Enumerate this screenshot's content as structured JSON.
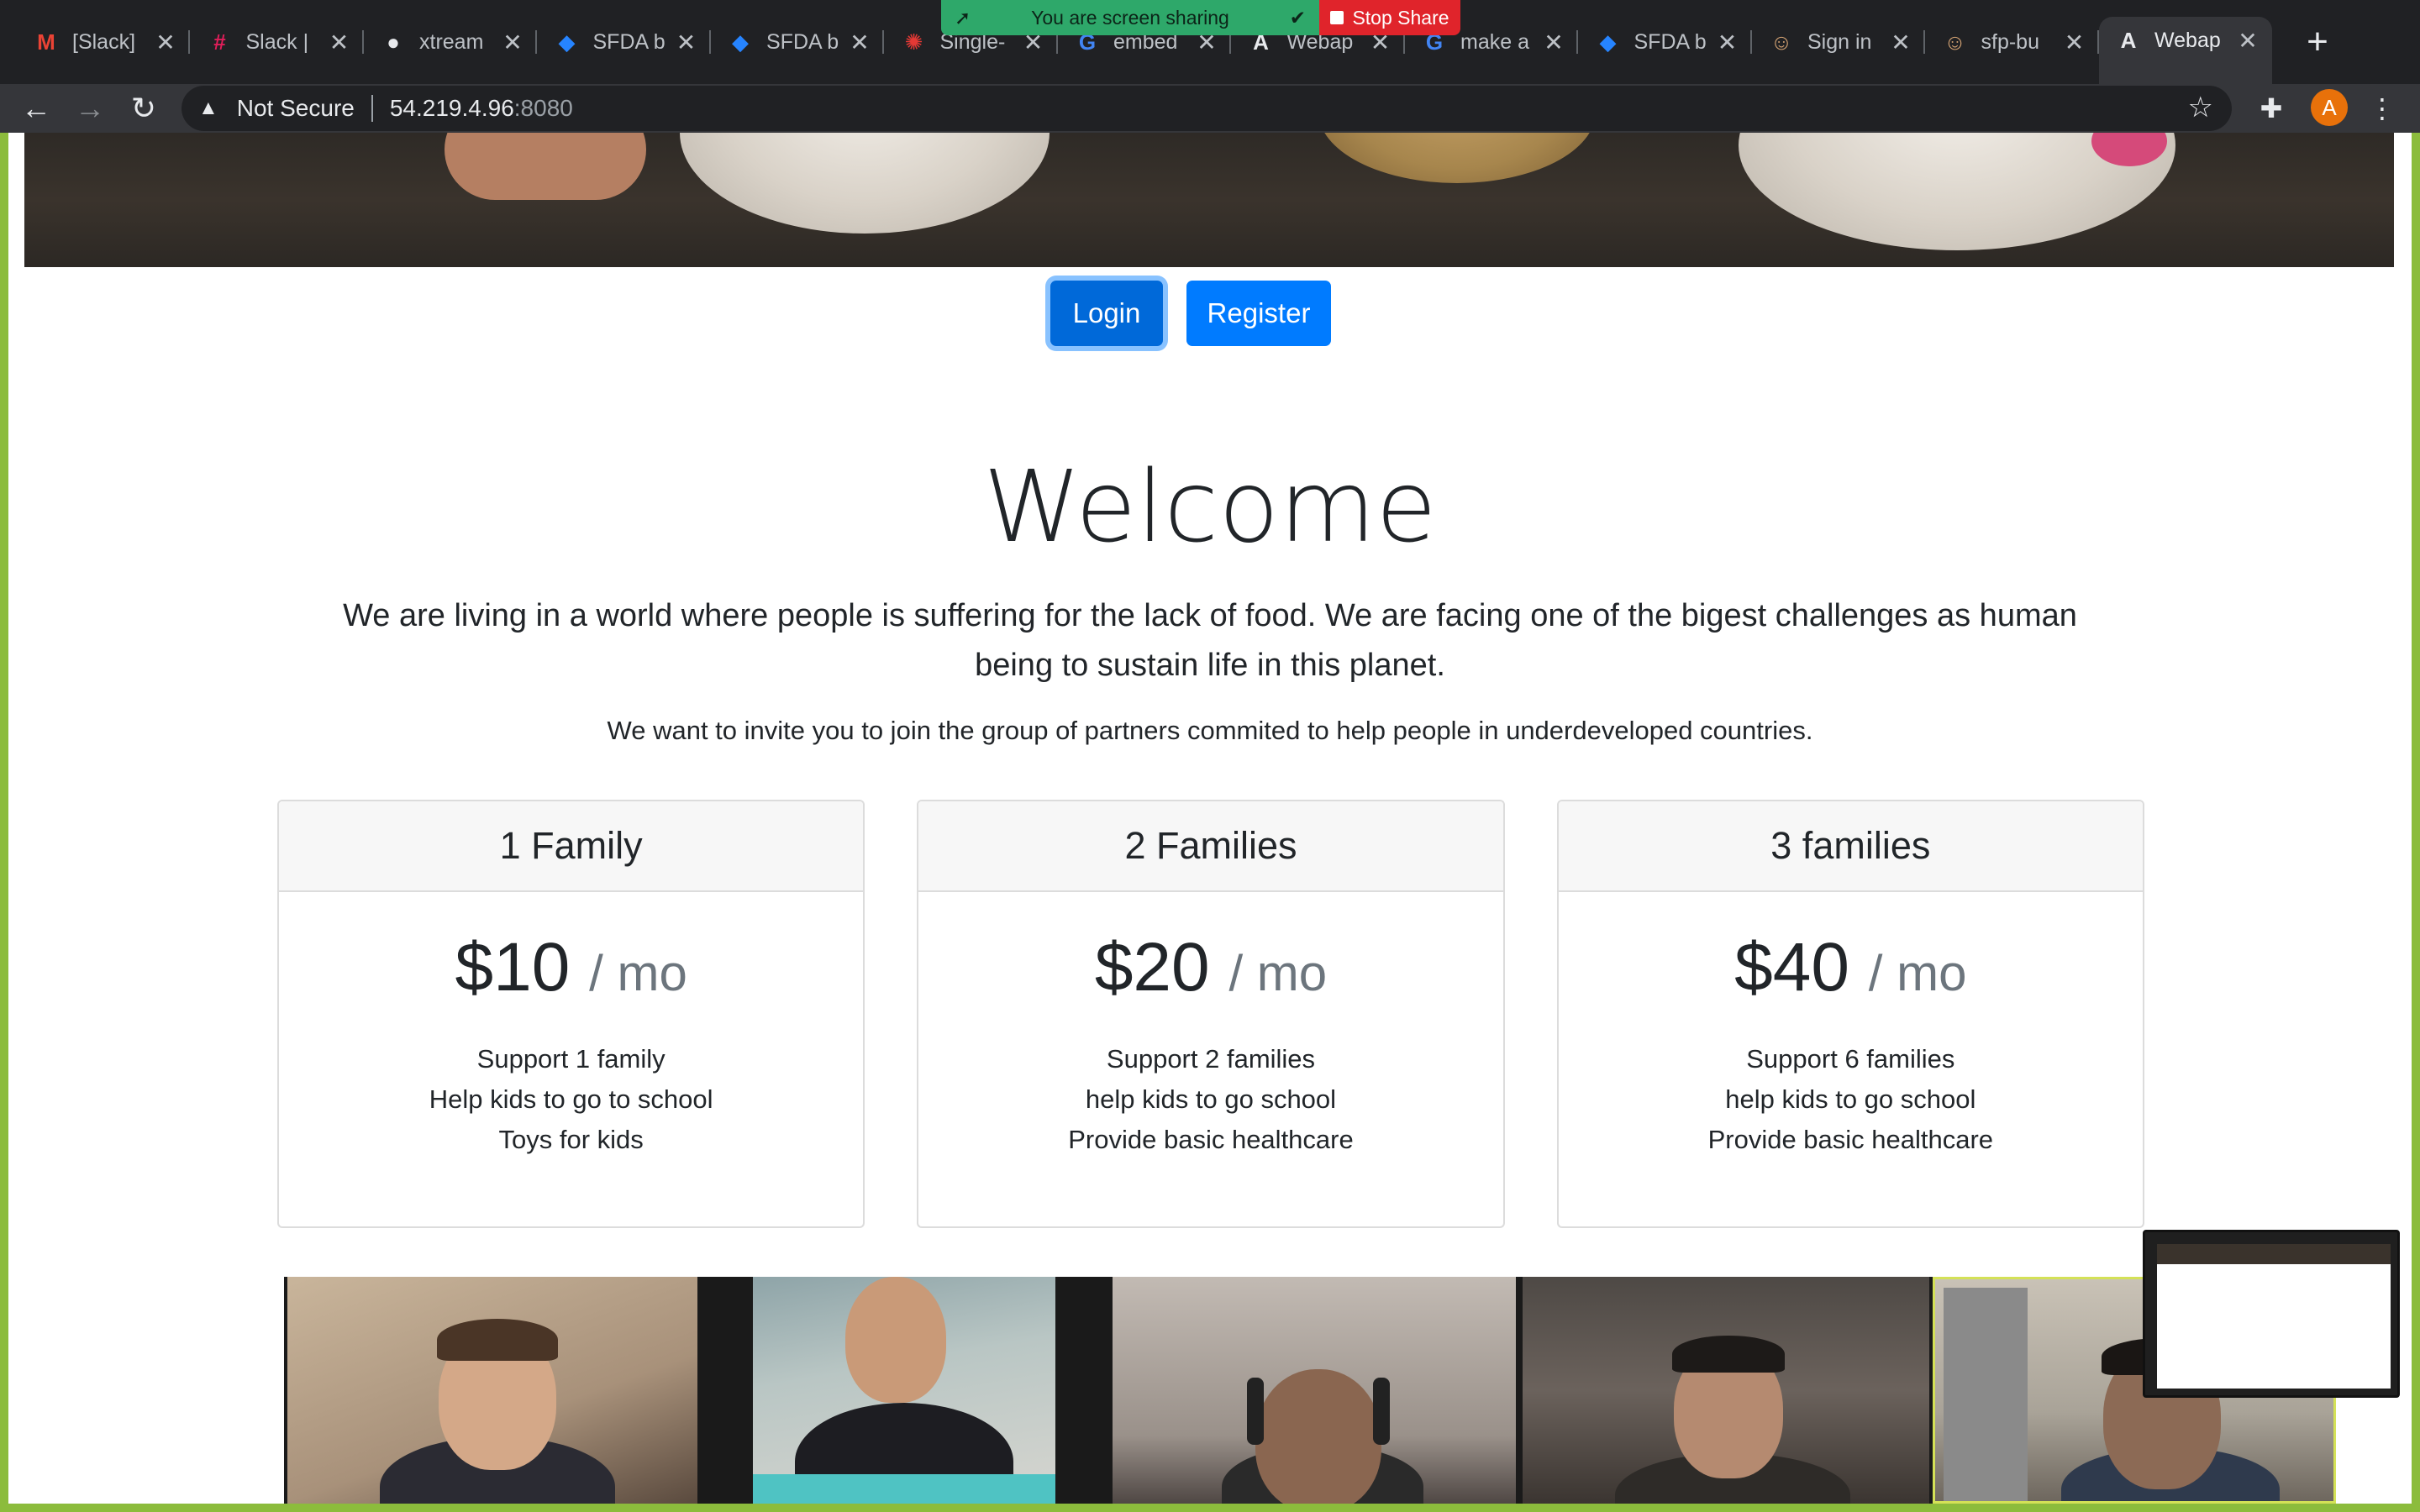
{
  "browser": {
    "tabs": [
      {
        "title": "[Slack]",
        "icon": "gmail-icon",
        "color": "#ea4335",
        "glyph": "M"
      },
      {
        "title": "Slack |",
        "icon": "slack-icon",
        "color": "#e01e5a",
        "glyph": "#"
      },
      {
        "title": "xtream",
        "icon": "github-icon",
        "color": "#e8eaed",
        "glyph": "●"
      },
      {
        "title": "SFDA b",
        "icon": "jira-icon",
        "color": "#2684ff",
        "glyph": "◆"
      },
      {
        "title": "SFDA b",
        "icon": "jira-icon",
        "color": "#2684ff",
        "glyph": "◆"
      },
      {
        "title": "Single-",
        "icon": "single-spa-icon",
        "color": "#e53935",
        "glyph": "✺"
      },
      {
        "title": "embed",
        "icon": "google-icon",
        "color": "#4285f4",
        "glyph": "G"
      },
      {
        "title": "Webap",
        "icon": "angular-icon",
        "color": "#e8eaed",
        "glyph": "A"
      },
      {
        "title": "make a",
        "icon": "google-icon",
        "color": "#4285f4",
        "glyph": "G"
      },
      {
        "title": "SFDA b",
        "icon": "jira-icon",
        "color": "#2684ff",
        "glyph": "◆"
      },
      {
        "title": "Sign in",
        "icon": "jenkins-icon",
        "color": "#d4a373",
        "glyph": "☺"
      },
      {
        "title": "sfp-bu",
        "icon": "jenkins-icon",
        "color": "#d4a373",
        "glyph": "☺"
      },
      {
        "title": "Webap",
        "icon": "angular-icon",
        "color": "#e8eaed",
        "glyph": "A",
        "active": true
      }
    ],
    "screen_share": {
      "status": "You are screen sharing",
      "stop_label": "Stop Share"
    },
    "address": {
      "security": "Not Secure",
      "host": "54.219.4.96",
      "port": ":8080"
    },
    "profile_initial": "A"
  },
  "page": {
    "auth": {
      "login_label": "Login",
      "register_label": "Register"
    },
    "welcome": {
      "heading": "Welcome",
      "lead": "We are living in a world where people is suffering for the lack of food. We are facing one of the bigest challenges as human being to sustain life in this planet.",
      "invite": "We want to invite you to join the group of partners commited to help people in underdeveloped countries."
    },
    "plans": [
      {
        "name": "1 Family",
        "price": "$10",
        "period": "/ mo",
        "features": [
          "Support 1 family",
          "Help kids to go to school",
          "Toys for kids"
        ]
      },
      {
        "name": "2 Families",
        "price": "$20",
        "period": "/ mo",
        "features": [
          "Support 2 families",
          "help kids to go school",
          "Provide basic healthcare"
        ]
      },
      {
        "name": "3 families",
        "price": "$40",
        "period": "/ mo",
        "features": [
          "Support 6 families",
          "help kids to go school",
          "Provide basic healthcare"
        ]
      }
    ]
  },
  "colors": {
    "primary": "#007bff",
    "chrome_dark": "#202124",
    "share_green": "#2ea86a",
    "share_red": "#e0242b",
    "desktop_bg": "#8cbc3c"
  }
}
